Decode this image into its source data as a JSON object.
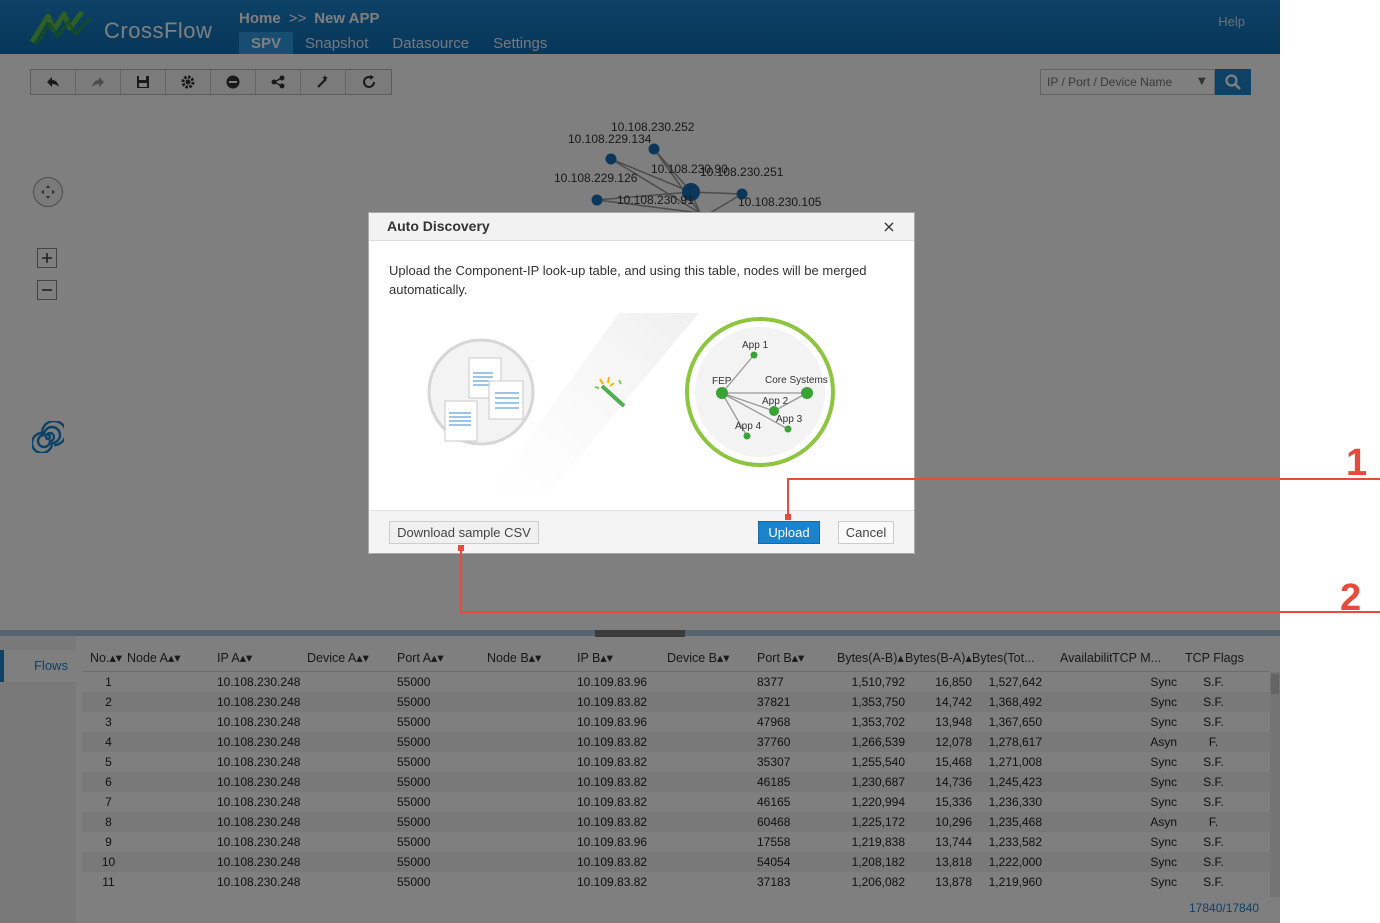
{
  "header": {
    "app_name": "CrossFlow",
    "breadcrumb_home": "Home",
    "breadcrumb_sep": ">>",
    "breadcrumb_current": "New APP",
    "help": "Help",
    "tabs": [
      {
        "label": "SPV",
        "active": true
      },
      {
        "label": "Snapshot",
        "active": false
      },
      {
        "label": "Datasource",
        "active": false
      },
      {
        "label": "Settings",
        "active": false
      }
    ]
  },
  "toolbar": {
    "buttons": [
      "undo-icon",
      "redo-icon",
      "save-icon",
      "settings-gear-icon",
      "minus-circle-icon",
      "share-nodes-icon",
      "magic-wand-icon",
      "refresh-icon"
    ]
  },
  "search": {
    "placeholder": "IP / Port / Device Name"
  },
  "graph": {
    "node_labels": [
      "10.108.230.252",
      "10.108.229.134",
      "10.108.230.90",
      "10.108.230.251",
      "10.108.229.126",
      "10.108.230.91",
      "10.108.230.105"
    ]
  },
  "dialog": {
    "title": "Auto Discovery",
    "close": "×",
    "description": "Upload the Component-IP look-up table, and using this table, nodes will be merged automatically.",
    "illustration": {
      "app1": "App 1",
      "fep": "FEP",
      "core": "Core Systems",
      "app2": "App 2",
      "app3": "App 3",
      "app4": "App 4"
    },
    "download_sample": "Download sample CSV",
    "upload": "Upload",
    "cancel": "Cancel"
  },
  "callouts": {
    "one": "1",
    "two": "2",
    "color": "#e84a3c"
  },
  "bottom_panel": {
    "side_tab": "Flows",
    "columns": [
      "No.",
      "Node A",
      "IP A",
      "Device A",
      "Port A",
      "Node B",
      "IP B",
      "Device B",
      "Port B",
      "Bytes(A-B)",
      "Bytes(B-A)",
      "Bytes(Tot...",
      "Availability",
      "TCP M...",
      "TCP Flags"
    ],
    "rows": [
      [
        "1",
        "",
        "10.108.230.248",
        "",
        "55000",
        "",
        "10.109.83.96",
        "",
        "8377",
        "1,510,792",
        "16,850",
        "1,527,642",
        "",
        "Sync",
        "S.F."
      ],
      [
        "2",
        "",
        "10.108.230.248",
        "",
        "55000",
        "",
        "10.109.83.82",
        "",
        "37821",
        "1,353,750",
        "14,742",
        "1,368,492",
        "",
        "Sync",
        "S.F."
      ],
      [
        "3",
        "",
        "10.108.230.248",
        "",
        "55000",
        "",
        "10.109.83.96",
        "",
        "47968",
        "1,353,702",
        "13,948",
        "1,367,650",
        "",
        "Sync",
        "S.F."
      ],
      [
        "4",
        "",
        "10.108.230.248",
        "",
        "55000",
        "",
        "10.109.83.82",
        "",
        "37760",
        "1,266,539",
        "12,078",
        "1,278,617",
        "",
        "Asyn",
        "F."
      ],
      [
        "5",
        "",
        "10.108.230.248",
        "",
        "55000",
        "",
        "10.109.83.82",
        "",
        "35307",
        "1,255,540",
        "15,468",
        "1,271,008",
        "",
        "Sync",
        "S.F."
      ],
      [
        "6",
        "",
        "10.108.230.248",
        "",
        "55000",
        "",
        "10.109.83.82",
        "",
        "46185",
        "1,230,687",
        "14,736",
        "1,245,423",
        "",
        "Sync",
        "S.F."
      ],
      [
        "7",
        "",
        "10.108.230.248",
        "",
        "55000",
        "",
        "10.109.83.82",
        "",
        "46165",
        "1,220,994",
        "15,336",
        "1,236,330",
        "",
        "Sync",
        "S.F."
      ],
      [
        "8",
        "",
        "10.108.230.248",
        "",
        "55000",
        "",
        "10.109.83.82",
        "",
        "60468",
        "1,225,172",
        "10,296",
        "1,235,468",
        "",
        "Asyn",
        "F."
      ],
      [
        "9",
        "",
        "10.108.230.248",
        "",
        "55000",
        "",
        "10.109.83.96",
        "",
        "17558",
        "1,219,838",
        "13,744",
        "1,233,582",
        "",
        "Sync",
        "S.F."
      ],
      [
        "10",
        "",
        "10.108.230.248",
        "",
        "55000",
        "",
        "10.109.83.82",
        "",
        "54054",
        "1,208,182",
        "13,818",
        "1,222,000",
        "",
        "Sync",
        "S.F."
      ],
      [
        "11",
        "",
        "10.108.230.248",
        "",
        "55000",
        "",
        "10.109.83.82",
        "",
        "37183",
        "1,206,082",
        "13,878",
        "1,219,960",
        "",
        "Sync",
        "S.F."
      ]
    ],
    "row_count": "17840/17840"
  }
}
